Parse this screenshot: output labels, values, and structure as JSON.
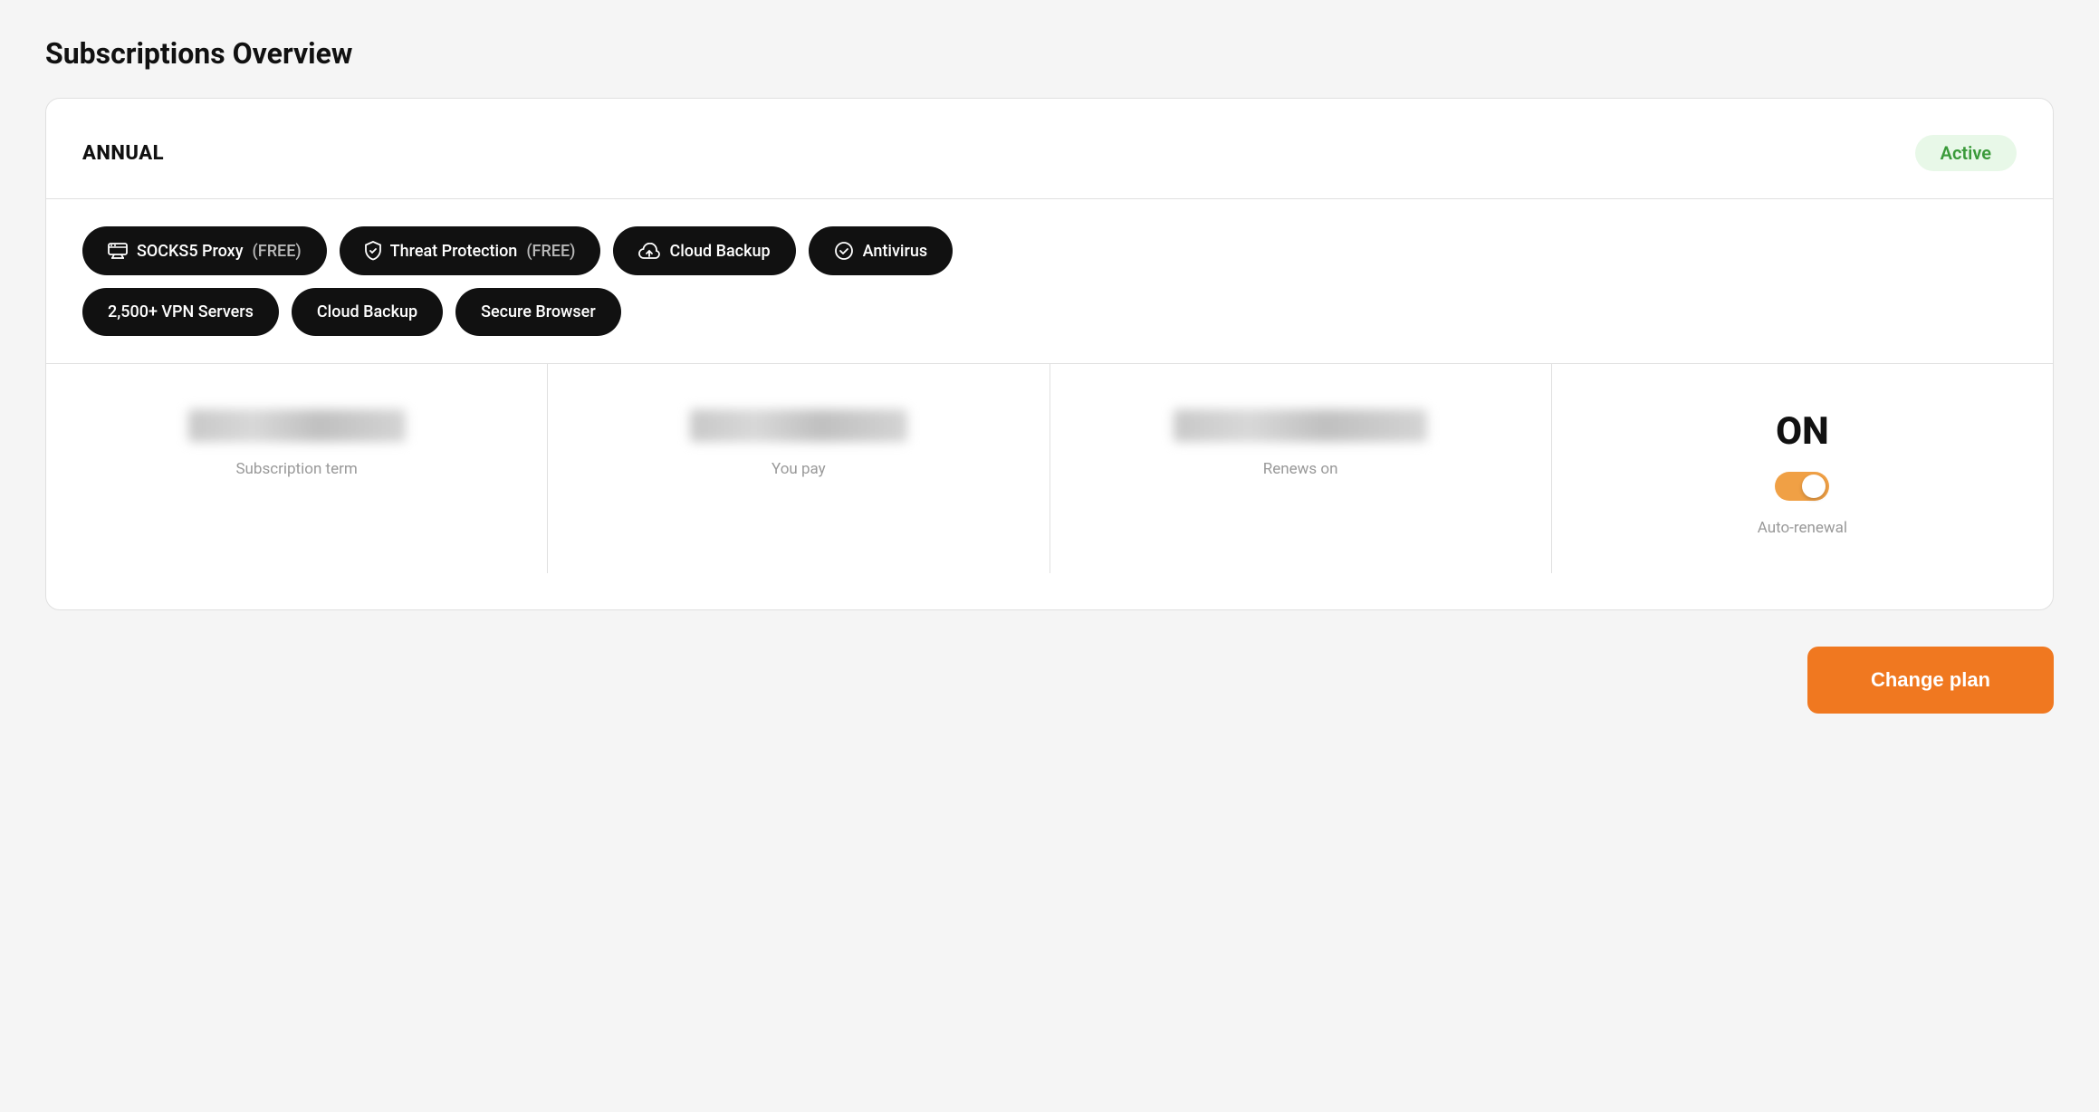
{
  "page": {
    "title": "Subscriptions Overview"
  },
  "subscription": {
    "plan_type": "ANNUAL",
    "status": "Active",
    "features_row1": [
      {
        "id": "socks5",
        "icon": "🖥",
        "label": "SOCKS5 Proxy",
        "tag": "(FREE)"
      },
      {
        "id": "threat",
        "icon": "🛡",
        "label": "Threat Protection",
        "tag": "(FREE)"
      },
      {
        "id": "cloud-backup-1",
        "icon": "☁",
        "label": "Cloud Backup",
        "tag": ""
      },
      {
        "id": "antivirus",
        "icon": "🛡",
        "label": "Antivirus",
        "tag": ""
      }
    ],
    "features_row2": [
      {
        "id": "vpn",
        "icon": "",
        "label": "2,500+ VPN Servers",
        "tag": ""
      },
      {
        "id": "cloud-backup-2",
        "icon": "",
        "label": "Cloud Backup",
        "tag": ""
      },
      {
        "id": "secure-browser",
        "icon": "",
        "label": "Secure Browser",
        "tag": ""
      }
    ],
    "stats": {
      "subscription_term": {
        "label": "Subscription term"
      },
      "you_pay": {
        "label": "You pay"
      },
      "renews_on": {
        "label": "Renews on"
      },
      "auto_renewal": {
        "label": "Auto-renewal",
        "value": "ON",
        "state": true
      }
    }
  },
  "buttons": {
    "change_plan": "Change plan"
  }
}
